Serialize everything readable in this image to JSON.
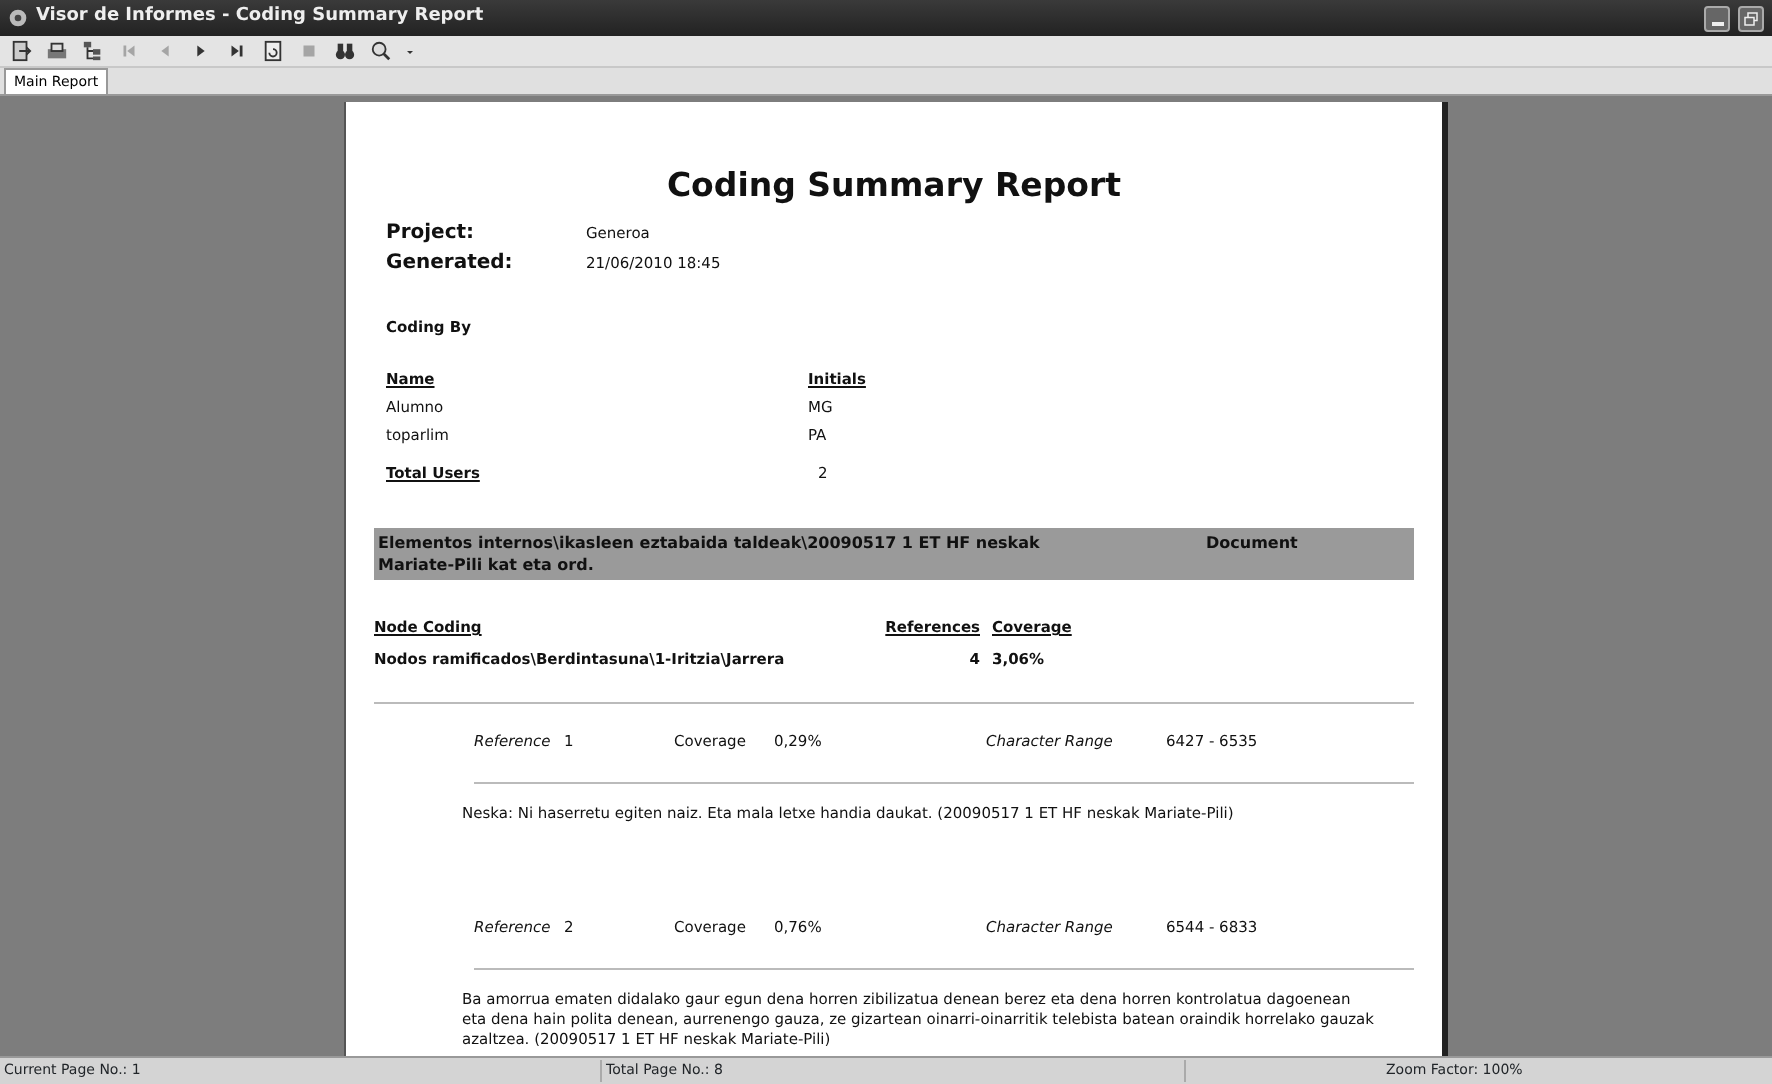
{
  "window": {
    "title": "Visor de Informes - Coding Summary Report",
    "controls": [
      {
        "kind": "minimize"
      },
      {
        "kind": "maximize"
      }
    ]
  },
  "toolbar": [
    {
      "kind": "export",
      "disabled": false
    },
    {
      "kind": "print",
      "disabled": false
    },
    {
      "kind": "tree",
      "disabled": false
    },
    {
      "kind": "first",
      "disabled": true
    },
    {
      "kind": "prev",
      "disabled": true
    },
    {
      "kind": "next",
      "disabled": false
    },
    {
      "kind": "last",
      "disabled": false
    },
    {
      "kind": "refresh",
      "disabled": false
    },
    {
      "kind": "stop",
      "disabled": true
    },
    {
      "kind": "find",
      "disabled": false
    },
    {
      "kind": "zoom",
      "disabled": false
    }
  ],
  "tabs": [
    {
      "label": "Main Report",
      "selected": true
    }
  ],
  "report": {
    "title": "Coding Summary Report",
    "meta": [
      {
        "label": "Project:",
        "value": "Generoa"
      },
      {
        "label": "Generated:",
        "value": "21/06/2010 18:45"
      }
    ],
    "coding_by": "Coding By",
    "users": {
      "columns": [
        "Name",
        "Initials"
      ],
      "rows": [
        [
          "Alumno",
          "MG"
        ],
        [
          "toparlim",
          "PA"
        ]
      ],
      "total_label": "Total Users",
      "total": "2"
    },
    "document_band": {
      "path": "Elementos internos\\ikasleen eztabaida taldeak\\20090517 1 ET HF neskak",
      "type": "Document",
      "path_cont": "Mariate-Pili kat eta ord."
    },
    "node_coding": {
      "columns": [
        "Node Coding",
        "References",
        "Coverage"
      ],
      "rows": [
        [
          "Nodos ramificados\\Berdintasuna\\1-Iritzia\\Jarrera",
          "4",
          "3,06%"
        ]
      ]
    },
    "references": [
      {
        "label": "Reference",
        "number": "1",
        "coverage_label": "Coverage",
        "coverage": "0,29%",
        "range_label": "Character Range",
        "range": "6427 - 6535",
        "text": "Neska:  Ni haserretu egiten naiz. Eta mala letxe handia daukat. (20090517 1 ET HF neskak Mariate-Pili)"
      },
      {
        "label": "Reference",
        "number": "2",
        "coverage_label": "Coverage",
        "coverage": "0,76%",
        "range_label": "Character Range",
        "range": "6544 - 6833",
        "text": "Ba amorrua ematen didalako gaur egun dena horren zibilizatua denean berez eta dena horren kontrolatua dagoenean eta dena hain polita denean, aurrenengo gauza, ze gizartean oinarri-oinarritik telebista batean oraindik horrelako gauzak azaltzea. (20090517 1 ET HF neskak Mariate-Pili)"
      }
    ]
  },
  "status_bar": [
    "Current Page No.: 1",
    "Total Page No.: 8",
    "Zoom Factor: 100%"
  ]
}
